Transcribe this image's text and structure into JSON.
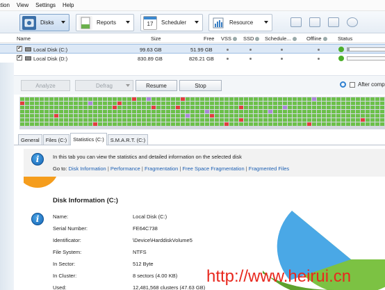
{
  "menu": [
    "ction",
    "View",
    "Settings",
    "Help"
  ],
  "toolbar": {
    "disks": "Disks",
    "reports": "Reports",
    "scheduler": "Scheduler",
    "scheduler_day": "17",
    "resource": "Resource"
  },
  "columns": {
    "name": "Name",
    "size": "Size",
    "free": "Free",
    "vss": "VSS",
    "ssd": "SSD",
    "schedule": "Schedule...",
    "offline": "Offline",
    "status": "Status"
  },
  "disks": [
    {
      "name": "Local Disk (C:)",
      "size": "99.63 GB",
      "free": "51.99 GB",
      "status_fill": 0.05
    },
    {
      "name": "Local Disk (D:)",
      "size": "830.89 GB",
      "free": "826.21 GB",
      "status_fill": 0.0
    }
  ],
  "controls": {
    "analyze": "Analyze",
    "defrag": "Defrag",
    "resume": "Resume",
    "stop": "Stop",
    "after": "After comp"
  },
  "tabs": [
    "General",
    "Files (C:)",
    "Statistics (C:)",
    "S.M.A.R.T. (C:)"
  ],
  "info": {
    "text": "In this tab you can view the statistics and detailed information on the selected disk",
    "goto_label": "Go to:",
    "links": [
      "Disk Information",
      "Performance",
      "Fragmentation",
      "Free Space Fragmentation",
      "Fragmented Files"
    ],
    "separator": "|"
  },
  "disk_info": {
    "title": "Disk Information (C:)",
    "rows": [
      {
        "k": "Name:",
        "v": "Local Disk (C:)"
      },
      {
        "k": "Serial Number:",
        "v": "FE64C738"
      },
      {
        "k": "Identificator:",
        "v": "\\Device\\HarddiskVolume5"
      },
      {
        "k": "File System:",
        "v": "NTFS"
      },
      {
        "k": "In Sector:",
        "v": "512 Byte"
      },
      {
        "k": "In Cluster:",
        "v": "8 sectors (4.00 KB)"
      },
      {
        "k": "Used:",
        "v": "12,481,568 clusters (47.63 GB)"
      }
    ]
  },
  "watermark": "http://www.heirui.cn",
  "colors": {
    "map_green": "#6cc04a",
    "map_red": "#e0403c",
    "map_purple": "#a987d6",
    "accent_blue": "#1c5fb3",
    "pie_green": "#7cc243",
    "pie_blue": "#4aa8e6",
    "orange": "#f59d1d"
  }
}
